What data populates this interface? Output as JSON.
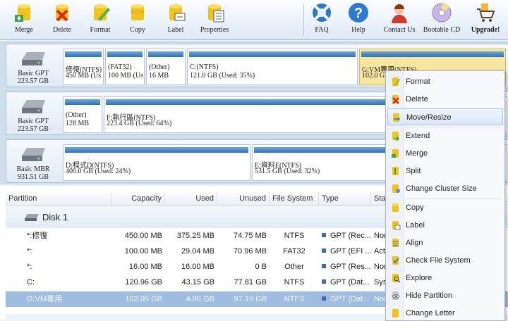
{
  "toolbar": {
    "left": [
      {
        "label": "Merge",
        "icon": "merge-icon"
      },
      {
        "label": "Delete",
        "icon": "delete-icon"
      },
      {
        "label": "Format",
        "icon": "format-icon"
      },
      {
        "label": "Copy",
        "icon": "copy-icon"
      },
      {
        "label": "Label",
        "icon": "label-icon"
      },
      {
        "label": "Properties",
        "icon": "properties-icon"
      }
    ],
    "right": [
      {
        "label": "FAQ",
        "icon": "lifebuoy-icon"
      },
      {
        "label": "Help",
        "icon": "help-icon"
      },
      {
        "label": "Contact Us",
        "icon": "contact-icon"
      },
      {
        "label": "Bootable CD",
        "icon": "cd-icon"
      },
      {
        "label": "Upgrade!",
        "icon": "cart-icon"
      }
    ]
  },
  "disks": [
    {
      "type": "Basic GPT",
      "size": "223.57 GB",
      "partitions": [
        {
          "name": "修復(NTFS)",
          "detail": "450 MB (Us"
        },
        {
          "name": "(FAT32)",
          "detail": "100 MB (Us"
        },
        {
          "name": "(Other)",
          "detail": "16 MB"
        },
        {
          "name": "C:(NTFS)",
          "detail": "121.0 GB (Used: 35%)"
        },
        {
          "name": "G:VM專用(NTFS)",
          "detail": "102.0 G"
        }
      ]
    },
    {
      "type": "Basic GPT",
      "size": "223.57 GB",
      "partitions": [
        {
          "name": "(Other)",
          "detail": "128 MB"
        },
        {
          "name": "F:執行區(NTFS)",
          "detail": "223.4 GB (Used: 64%)"
        }
      ]
    },
    {
      "type": "Basic MBR",
      "size": "931.51 GB",
      "partitions": [
        {
          "name": "D:程式D(NTFS)",
          "detail": "400.0 GB (Used: 24%)"
        },
        {
          "name": "E:資料E(NTFS)",
          "detail": "531.5 GB (Used: 32%)"
        }
      ]
    }
  ],
  "list": {
    "headers": [
      "Partition",
      "Capacity",
      "Used",
      "Unused",
      "File System",
      "Type",
      "Stat"
    ],
    "group": "Disk 1",
    "rows": [
      {
        "partition": "*:修復",
        "capacity": "450.00 MB",
        "used": "375.25 MB",
        "unused": "74.75 MB",
        "fs": "NTFS",
        "type": "GPT (Rec...",
        "status": "Nor"
      },
      {
        "partition": "*:",
        "capacity": "100.00 MB",
        "used": "29.04 MB",
        "unused": "70.96 MB",
        "fs": "FAT32",
        "type": "GPT (EFI ...",
        "status": "Acti"
      },
      {
        "partition": "*:",
        "capacity": "16.00 MB",
        "used": "16.00 MB",
        "unused": "0 B",
        "fs": "Other",
        "type": "GPT (Res...",
        "status": "Nor"
      },
      {
        "partition": "C:",
        "capacity": "120.96 GB",
        "used": "43.15 GB",
        "unused": "77.81 GB",
        "fs": "NTFS",
        "type": "GPT (Dat...",
        "status": "Sys"
      },
      {
        "partition": "G:VM專用",
        "capacity": "102.05 GB",
        "used": "4.86 GB",
        "unused": "97.19 GB",
        "fs": "NTFS",
        "type": "GPT (Dat...",
        "status": "Nor"
      }
    ]
  },
  "context_menu": {
    "items": [
      {
        "label": "Format",
        "icon": "format-icon"
      },
      {
        "label": "Delete",
        "icon": "delete-icon"
      },
      {
        "label": "Move/Resize",
        "icon": "move-resize-icon"
      },
      {
        "label": "Extend",
        "icon": "extend-icon"
      },
      {
        "label": "Merge",
        "icon": "merge-icon"
      },
      {
        "label": "Split",
        "icon": "split-icon"
      },
      {
        "label": "Change Cluster Size",
        "icon": "cluster-size-icon"
      },
      {
        "label": "Copy",
        "icon": "copy-icon"
      },
      {
        "label": "Label",
        "icon": "label-icon"
      },
      {
        "label": "Align",
        "icon": "align-icon"
      },
      {
        "label": "Check File System",
        "icon": "check-file-system-icon"
      },
      {
        "label": "Explore",
        "icon": "explore-icon"
      },
      {
        "label": "Hide Partition",
        "icon": "hide-partition-icon"
      },
      {
        "label": "Change Letter",
        "icon": "change-letter-icon"
      }
    ]
  },
  "colors": {
    "bar": "#2b73bd",
    "selected_partition": "#f8e59e",
    "selected_row": "#9fbde0"
  }
}
